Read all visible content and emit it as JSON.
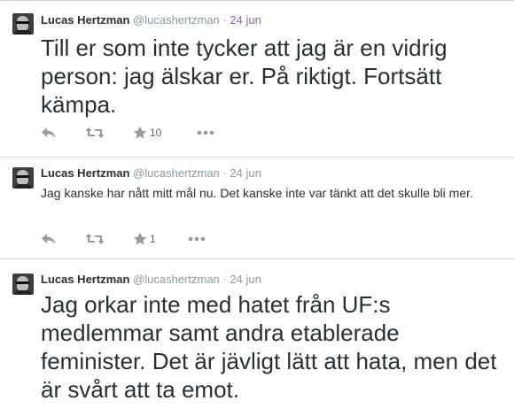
{
  "tweets": [
    {
      "name": "Lucas Hertzman",
      "handle": "@lucashertzman",
      "separator": "·",
      "time": "24 jun",
      "text": "Till er som inte tycker att jag är en vidrig person: jag älskar er. På riktigt. Fortsätt kämpa.",
      "favorites": "10"
    },
    {
      "name": "Lucas Hertzman",
      "handle": "@lucashertzman",
      "separator": "·",
      "time": "24 jun",
      "text": "Jag kanske har nått mitt mål nu. Det kanske inte var tänkt att det skulle bli mer.",
      "favorites": "1"
    },
    {
      "name": "Lucas Hertzman",
      "handle": "@lucashertzman",
      "separator": "·",
      "time": "24 jun",
      "text": "Jag orkar inte med hatet från UF:s medlemmar samt andra etablerade feminister. Det är jävligt lätt att hata, men det är svårt att ta emot."
    }
  ],
  "icons": {
    "reply": "reply-icon",
    "retweet": "retweet-icon",
    "favorite": "star-icon",
    "more": "more-icon"
  },
  "colors": {
    "time_first": "#8b5fbf",
    "meta": "#8899a6",
    "text": "#292f33",
    "icon": "#999999",
    "divider": "#d6d6d6"
  }
}
